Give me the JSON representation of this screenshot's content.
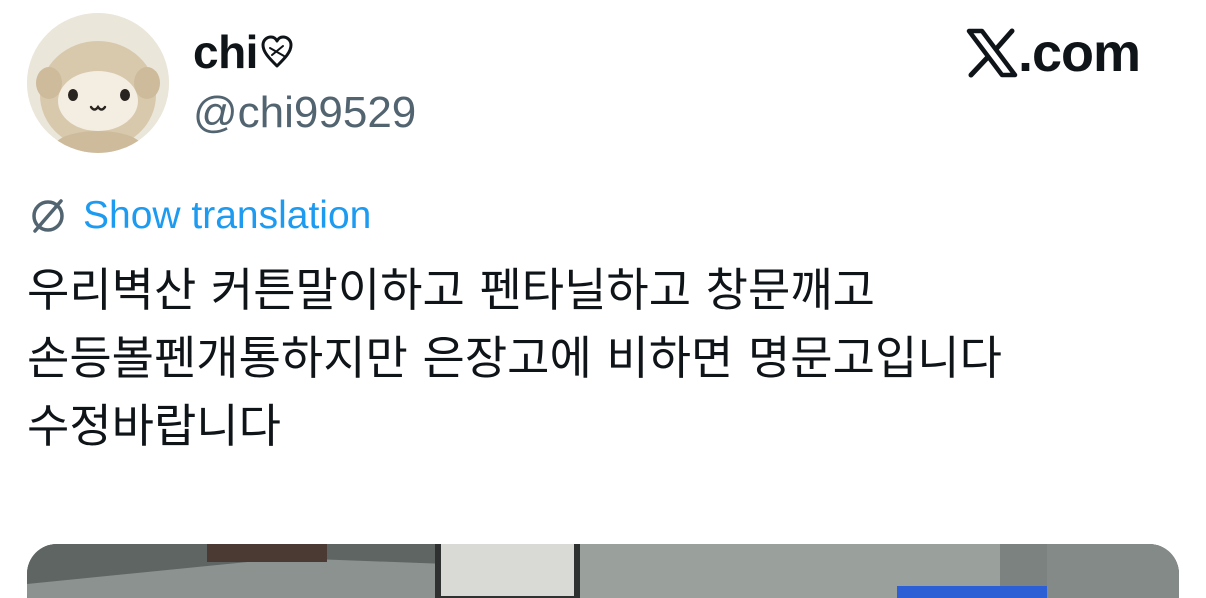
{
  "author": {
    "display_name": "chi",
    "handle": "@chi99529",
    "avatar": "plush-toy-avatar",
    "name_icon": "heart-icon"
  },
  "brand": {
    "logo": "x-logo-icon",
    "domain_suffix": ".com"
  },
  "translation": {
    "icon": "globe-icon",
    "label": "Show translation",
    "color": "#1d9bf0"
  },
  "tweet": {
    "text": "우리벽산 커튼말이하고 펜타닐하고 창문깨고 손등볼펜개통하지만 은장고에 비하면 명문고입니다 수정바랍니다"
  },
  "media": {
    "kind": "photo-preview"
  },
  "colors": {
    "text_primary": "#0f1419",
    "text_secondary": "#536471",
    "link": "#1d9bf0",
    "background": "#ffffff"
  }
}
